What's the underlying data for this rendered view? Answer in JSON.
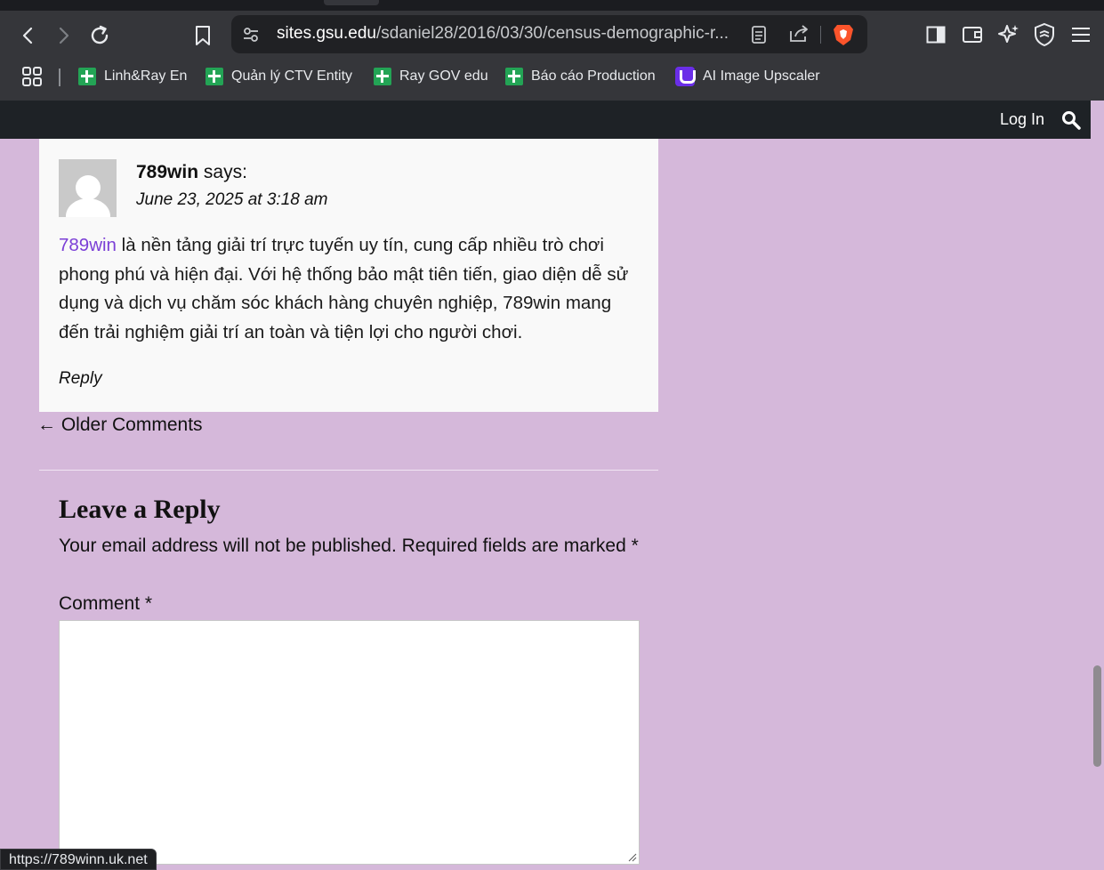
{
  "browser": {
    "url_host": "sites.gsu.edu",
    "url_rest": "/sdaniel28/2016/03/30/census-demographic-r...",
    "bookmarks": [
      {
        "label": "Linh&Ray En",
        "icon": "spreadsheet-icon"
      },
      {
        "label": "Quản lý CTV Entity",
        "icon": "spreadsheet-icon"
      },
      {
        "label": "Ray GOV edu",
        "icon": "spreadsheet-icon"
      },
      {
        "label": "Báo cáo Production",
        "icon": "spreadsheet-icon"
      },
      {
        "label": "AI Image Upscaler",
        "icon": "ai-upscaler-icon"
      }
    ],
    "status_url": "https://789winn.uk.net",
    "colors": {
      "chrome": "#35363a",
      "urlbar": "#202124",
      "brave_orange": "#fb542b"
    }
  },
  "site_header": {
    "login_label": "Log In",
    "search_icon": "search-icon"
  },
  "comment": {
    "author": "789win",
    "says": "says:",
    "date": "June 23, 2025 at 3:18 am",
    "link_text": "789win",
    "body_text": " là nền tảng giải trí trực tuyến uy tín, cung cấp nhiều trò chơi phong phú và hiện đại. Với hệ thống bảo mật tiên tiến, giao diện dễ sử dụng và dịch vụ chăm sóc khách hàng chuyên nghiệp, 789win mang đến trải nghiệm giải trí an toàn và tiện lợi cho người chơi.",
    "reply_label": "Reply"
  },
  "older_comments": "← Older Comments",
  "reply_form": {
    "title": "Leave a Reply",
    "notes": "Your email address will not be published. Required fields are marked",
    "required_mark": "*",
    "comment_label": "Comment",
    "comment_value": ""
  },
  "theme": {
    "page_bg": "#d5b8da",
    "header_bg": "#1e2226",
    "card_bg": "#f9f9f9",
    "link_color": "#7b3fd6"
  }
}
